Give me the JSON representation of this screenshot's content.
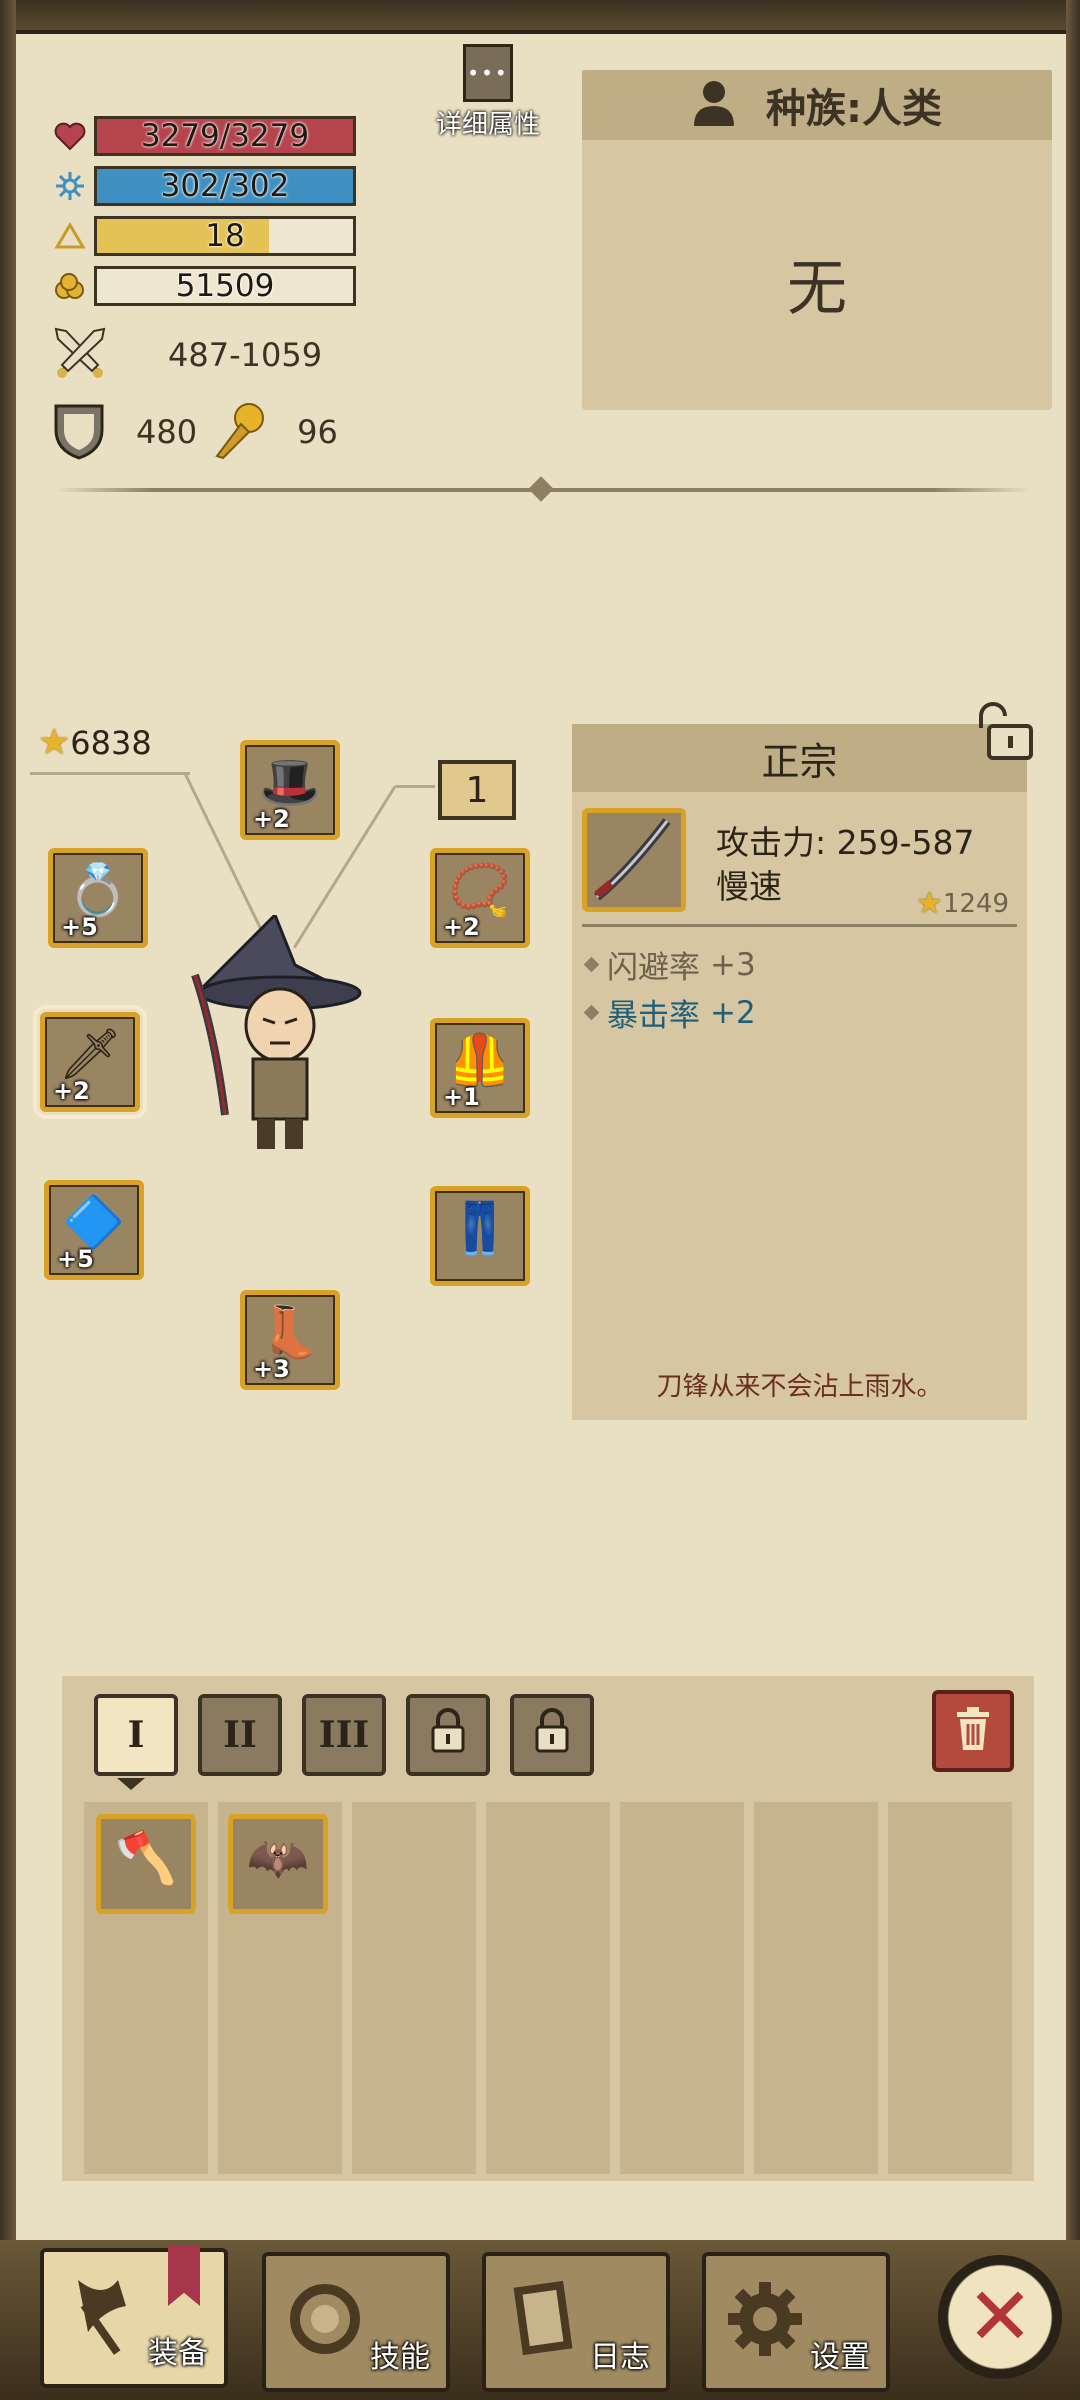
{
  "stats": {
    "hp": {
      "text": "3279/3279",
      "fill": 1.0,
      "color": "#b5444c"
    },
    "mp": {
      "text": "302/302",
      "fill": 1.0,
      "color": "#3f8fc1"
    },
    "level": {
      "text": "18",
      "fill": 0.67,
      "color": "#e4c255"
    },
    "gold": {
      "text": "51509",
      "fill": 0.0,
      "color": "#e4c255"
    },
    "attack": "487-1059",
    "defense": "480",
    "luck": "96"
  },
  "detail_button": {
    "label": "详细属性",
    "dots": "•••"
  },
  "race": {
    "title": "种族:人类",
    "value": "无"
  },
  "score": "6838",
  "level_badge": "1",
  "equipment": [
    {
      "name": "hat",
      "plus": "+2",
      "glyph": "🎩"
    },
    {
      "name": "ring",
      "plus": "+5",
      "glyph": "💍"
    },
    {
      "name": "necklace",
      "plus": "+2",
      "glyph": "📿"
    },
    {
      "name": "weapon",
      "plus": "+2",
      "glyph": "🗡"
    },
    {
      "name": "armor",
      "plus": "+1",
      "glyph": "🦺"
    },
    {
      "name": "offhand",
      "plus": "+5",
      "glyph": "🔷"
    },
    {
      "name": "pants",
      "plus": "",
      "glyph": "👖"
    },
    {
      "name": "boots",
      "plus": "+3",
      "glyph": "👢"
    }
  ],
  "item": {
    "name": "正宗",
    "attack": "攻击力: 259-587",
    "speed": "慢速",
    "score": "1249",
    "affixes": [
      {
        "label": "闪避率",
        "value": "+3"
      },
      {
        "label": "暴击率",
        "value": "+2"
      }
    ],
    "flavor": "刀锋从来不会沾上雨水。"
  },
  "inventory": {
    "tabs": [
      "I",
      "II",
      "III"
    ],
    "items": [
      {
        "glyph": "🪓"
      },
      {
        "glyph": "🦇"
      }
    ]
  },
  "nav": {
    "equip": "装备",
    "skills": "技能",
    "log": "日志",
    "settings": "设置"
  },
  "colors": {
    "slot_border": "#d8a227",
    "accent_red": "#b3343a",
    "affix_blue": "#1f5f7a"
  }
}
